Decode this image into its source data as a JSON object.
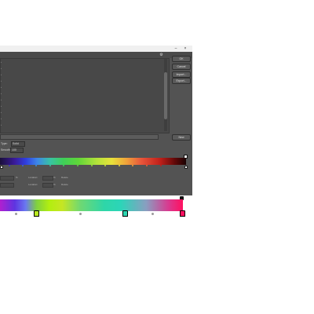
{
  "dialog": {
    "ok_label": "OK",
    "cancel_label": "Cancel",
    "import_label": "Import...",
    "export_label": "Export...",
    "new_label": "New",
    "presets_gear": "gear-icon"
  },
  "controls": {
    "type_label": "Type:",
    "type_value": "Solid",
    "smooth_label": "Smooth:",
    "smooth_value": "100"
  },
  "stops": {
    "opacity_label": "Opacity:",
    "location_label": "Location:",
    "delete_label": "Delete",
    "color_label": "Color:",
    "location_label_2": "Location:",
    "delete_label_2": "Delete"
  },
  "colors": {
    "window_bg": "#535353",
    "panel_bg": "#484848",
    "selected_stop": "#ff1060"
  }
}
